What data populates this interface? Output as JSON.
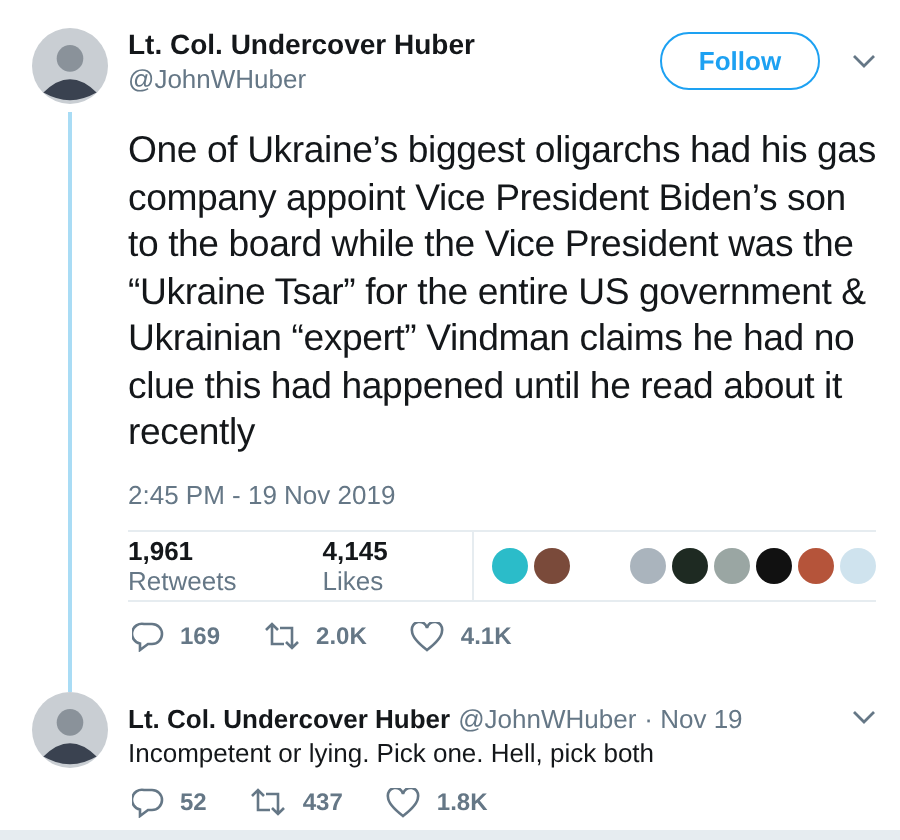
{
  "tweet": {
    "name": "Lt. Col. Undercover Huber",
    "handle": "@JohnWHuber",
    "follow_label": "Follow",
    "text": "One of Ukraine’s biggest oligarchs had his gas company appoint Vice President Biden’s son to the board while the Vice President was the “Ukraine Tsar” for the entire US government & Ukrainian “expert” Vindman claims he had no clue this had happened until he read about it recently",
    "timestamp": "2:45 PM - 19 Nov 2019",
    "retweets_count": "1,961",
    "retweets_label": "Retweets",
    "likes_count": "4,145",
    "likes_label": "Likes",
    "likers": [
      {
        "color": "#2bbcc9"
      },
      {
        "color": "#7a4a3a"
      },
      {
        "color": "#aab4bd"
      },
      {
        "color": "#1e2a22"
      },
      {
        "color": "#9aa6a3"
      },
      {
        "color": "#111111"
      },
      {
        "color": "#b5543a"
      },
      {
        "color": "#cfe3ee"
      }
    ],
    "actions": {
      "replies": "169",
      "retweets": "2.0K",
      "likes": "4.1K"
    }
  },
  "reply": {
    "name": "Lt. Col. Undercover Huber",
    "handle": "@JohnWHuber",
    "date": "· Nov 19",
    "text": "Incompetent or lying. Pick one. Hell, pick both",
    "actions": {
      "replies": "52",
      "retweets": "437",
      "likes": "1.8K"
    }
  }
}
